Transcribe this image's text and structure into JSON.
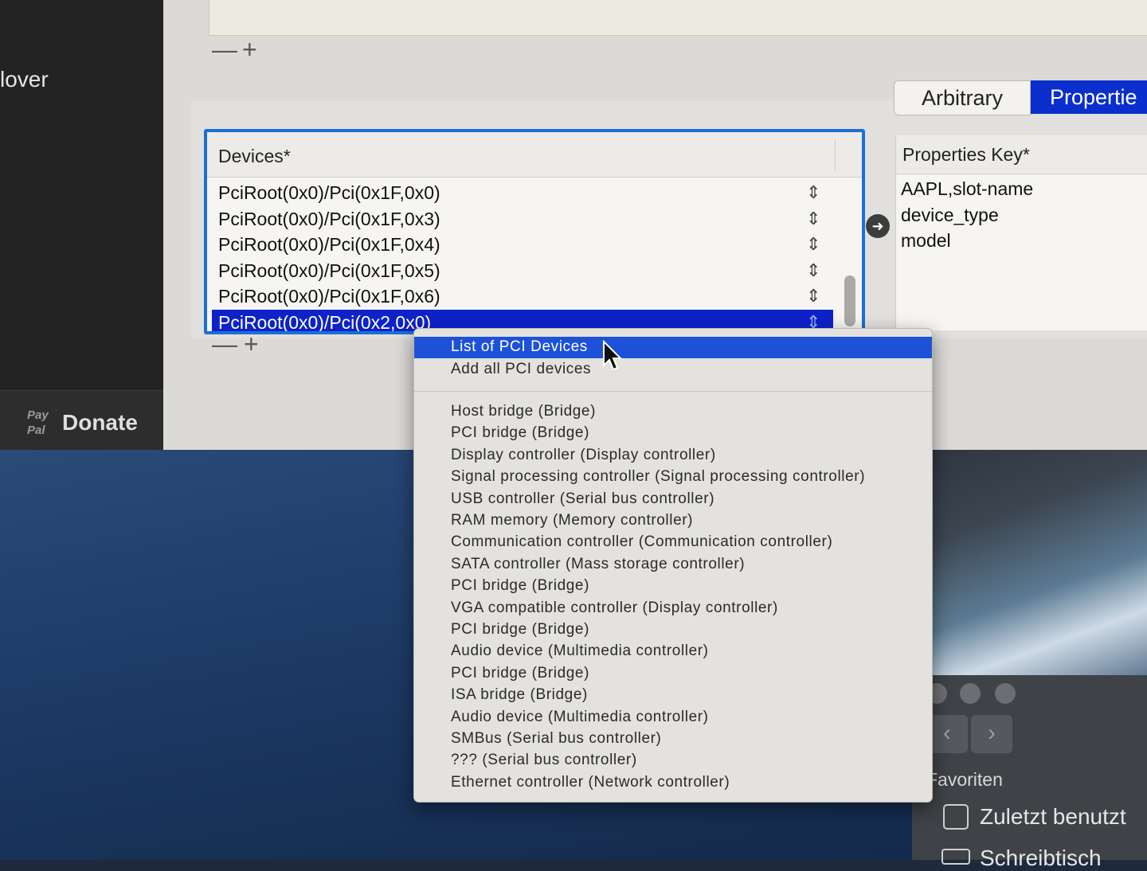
{
  "sidebar": {
    "app_name": "lover",
    "paypal_logo": "Pay Pal",
    "donate_label": "Donate"
  },
  "top_controls": {
    "remove_label": "—",
    "add_label": "+"
  },
  "segmented": {
    "arbitrary_label": "Arbitrary",
    "properties_label": "Propertie"
  },
  "devices": {
    "header": "Devices*",
    "stepper_symbol": "⇕",
    "rows": [
      "PciRoot(0x0)/Pci(0x1F,0x0)",
      "PciRoot(0x0)/Pci(0x1F,0x3)",
      "PciRoot(0x0)/Pci(0x1F,0x4)",
      "PciRoot(0x0)/Pci(0x1F,0x5)",
      "PciRoot(0x0)/Pci(0x1F,0x6)",
      "PciRoot(0x0)/Pci(0x2,0x0)"
    ],
    "selected_index": 5,
    "remove_label": "—",
    "add_label": "+"
  },
  "arrow_icon": "➜",
  "properties": {
    "header": "Properties Key*",
    "rows": [
      "AAPL,slot-name",
      "device_type",
      "model"
    ]
  },
  "menu": {
    "top_items": [
      "List of PCI Devices",
      "Add all PCI devices"
    ],
    "highlighted_index": 0,
    "devices": [
      "Host bridge (Bridge)",
      "PCI bridge (Bridge)",
      "Display controller (Display controller)",
      "Signal processing controller (Signal processing controller)",
      "USB controller (Serial bus controller)",
      "RAM memory (Memory controller)",
      "Communication controller (Communication controller)",
      "SATA controller (Mass storage controller)",
      "PCI bridge (Bridge)",
      "VGA compatible controller (Display controller)",
      "PCI bridge (Bridge)",
      "Audio device (Multimedia controller)",
      "PCI bridge (Bridge)",
      "ISA bridge (Bridge)",
      "Audio device (Multimedia controller)",
      "SMBus (Serial bus controller)",
      "??? (Serial bus controller)",
      "Ethernet controller (Network controller)"
    ]
  },
  "finder": {
    "back_icon": "‹",
    "forward_icon": "›",
    "favorites_label": "Favoriten",
    "recent_label": "Zuletzt benutzt",
    "desktop_label": "Schreibtisch"
  },
  "colors": {
    "selection": "#0d22c9",
    "menu_highlight": "#1d52d8",
    "focus_ring": "#1b6fd6"
  }
}
